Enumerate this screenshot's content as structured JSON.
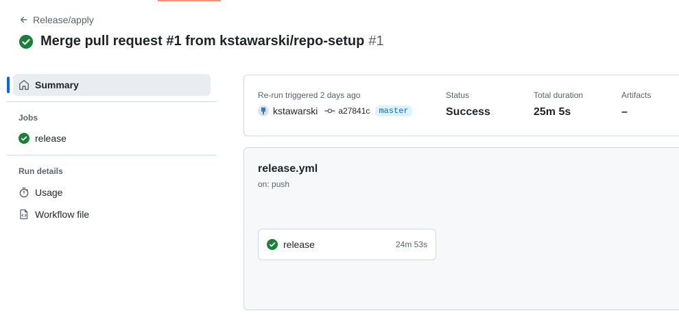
{
  "header": {
    "back_label": "Release/apply",
    "run_title": "Merge pull request #1 from kstawarski/repo-setup",
    "run_number": "#1"
  },
  "sidebar": {
    "summary_label": "Summary",
    "jobs_heading": "Jobs",
    "jobs": [
      {
        "label": "release",
        "status": "success"
      }
    ],
    "run_details_heading": "Run details",
    "details": [
      {
        "label": "Usage",
        "icon": "stopwatch-icon"
      },
      {
        "label": "Workflow file",
        "icon": "file-code-icon"
      }
    ]
  },
  "summary": {
    "trigger_label": "Re-run triggered 2 days ago",
    "actor": "kstawarski",
    "commit": "a27841c",
    "branch": "master",
    "status_label": "Status",
    "status_value": "Success",
    "duration_label": "Total duration",
    "duration_value": "25m 5s",
    "artifacts_label": "Artifacts",
    "artifacts_value": "–"
  },
  "workflow": {
    "file_name": "release.yml",
    "trigger": "on: push",
    "job": {
      "name": "release",
      "duration": "24m 53s"
    }
  },
  "colors": {
    "success": "#1a7f37",
    "accent": "#0969da",
    "tab_underline": "#fd8c73"
  }
}
